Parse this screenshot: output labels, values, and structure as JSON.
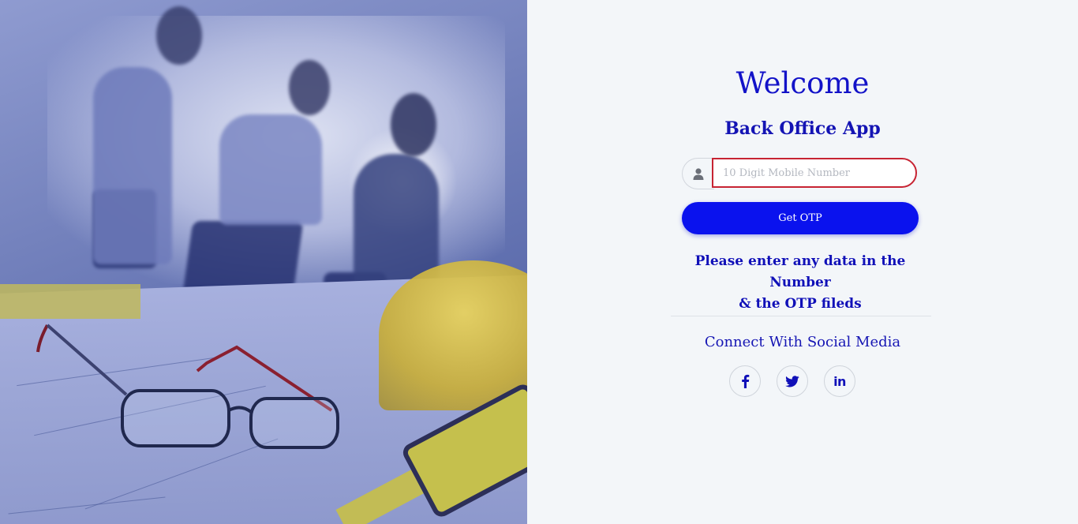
{
  "login": {
    "title": "Welcome",
    "subtitle": "Back Office App",
    "mobile_placeholder": "10 Digit Mobile Number",
    "mobile_value": "",
    "otp_button_label": "Get OTP",
    "hint_line1": "Please enter any data in the Number",
    "hint_line2": "& the OTP fileds"
  },
  "social": {
    "title": "Connect With Social Media",
    "items": [
      {
        "icon": "facebook-icon"
      },
      {
        "icon": "twitter-icon"
      },
      {
        "icon": "linkedin-icon",
        "text": "in"
      }
    ]
  },
  "theme": {
    "accent": "#0a12ee",
    "heading": "#1212c8",
    "input_border_error": "#c72433",
    "panel_background": "#f3f6f9",
    "hero_tint": "#5a6aab"
  },
  "hero": {
    "icon": "office-meeting-photo"
  }
}
